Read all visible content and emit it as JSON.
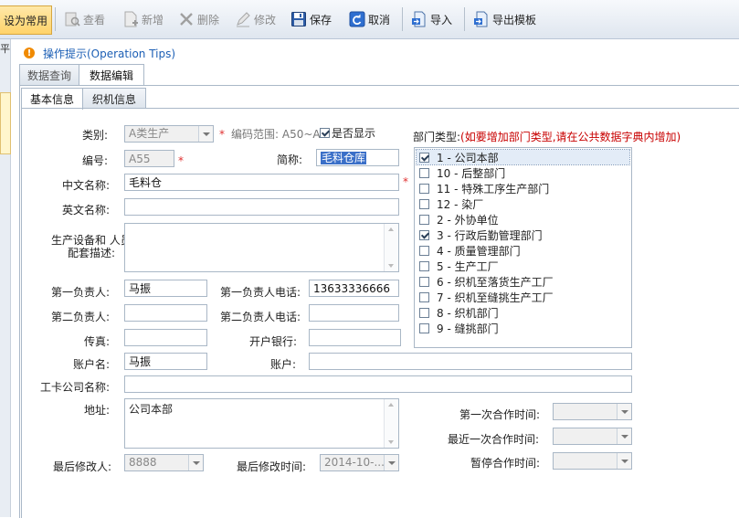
{
  "toolbar": {
    "set_common": "设为常用",
    "view": "查看",
    "add": "新增",
    "delete": "删除",
    "modify": "修改",
    "save": "保存",
    "cancel": "取消",
    "import": "导入",
    "export_template": "导出模板"
  },
  "left_strip_label": "平",
  "tips": {
    "label": "操作提示(Operation Tips)"
  },
  "tabs": [
    {
      "label": "数据查询"
    },
    {
      "label": "数据编辑"
    }
  ],
  "subtabs": [
    {
      "label": "基本信息"
    },
    {
      "label": "织机信息"
    }
  ],
  "form": {
    "category_label": "类别:",
    "category_value": "A类生产",
    "code_range_label": "编码范围: A50~A",
    "show_label": "是否显示",
    "show_checked": true,
    "code_label": "编号:",
    "code_value": "A55",
    "short_name_label": "简称:",
    "short_name_value": "毛料仓库",
    "cn_name_label": "中文名称:",
    "cn_name_value": "毛料仓",
    "en_name_label": "英文名称:",
    "en_name_value": "",
    "equipment_label_1": "生产设备和 人员",
    "equipment_label_2": "配套描述:",
    "equipment_value": "",
    "person1_label": "第一负责人:",
    "person1_value": "马振",
    "phone1_label": "第一负责人电话:",
    "phone1_value": "13633336666",
    "person2_label": "第二负责人:",
    "person2_value": "",
    "phone2_label": "第二负责人电话:",
    "phone2_value": "",
    "fax_label": "传真:",
    "fax_value": "",
    "bank_label": "开户银行:",
    "bank_value": "",
    "account_name_label": "账户名:",
    "account_name_value": "马振",
    "account_label": "账户:",
    "account_value": "",
    "card_company_label": "工卡公司名称:",
    "card_company_value": "",
    "address_label": "地址:",
    "address_value": "公司本部",
    "last_modifier_label": "最后修改人:",
    "last_modifier_value": "8888",
    "last_modified_label": "最后修改时间:",
    "last_modified_value": "2014-10-...",
    "first_coop_label": "第一次合作时间:",
    "first_coop_value": "",
    "recent_coop_label": "最近一次合作时间:",
    "recent_coop_value": "",
    "pause_coop_label": "暂停合作时间:",
    "pause_coop_value": ""
  },
  "dept": {
    "title": "部门类型:",
    "note": "(如要增加部门类型,请在公共数据字典内增加)",
    "items": [
      {
        "label": "1 - 公司本部",
        "checked": true
      },
      {
        "label": "10 - 后整部门",
        "checked": false
      },
      {
        "label": "11 - 特殊工序生产部门",
        "checked": false
      },
      {
        "label": "12 - 染厂",
        "checked": false
      },
      {
        "label": "2 - 外协单位",
        "checked": false
      },
      {
        "label": "3 - 行政后勤管理部门",
        "checked": true
      },
      {
        "label": "4 - 质量管理部门",
        "checked": false
      },
      {
        "label": "5 - 生产工厂",
        "checked": false
      },
      {
        "label": "6 - 织机至落货生产工厂",
        "checked": false
      },
      {
        "label": "7 - 织机至缝挑生产工厂",
        "checked": false
      },
      {
        "label": "8 - 织机部门",
        "checked": false
      },
      {
        "label": "9 - 缝挑部门",
        "checked": false
      }
    ]
  }
}
